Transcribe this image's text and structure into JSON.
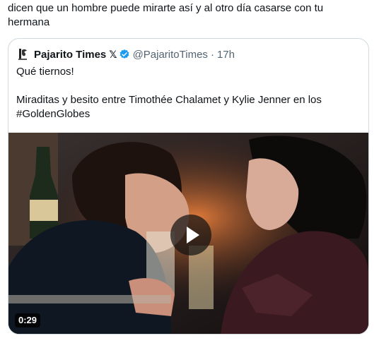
{
  "tweet": {
    "text": "dicen que un hombre puede mirarte así y al otro día casarse con tu hermana"
  },
  "quoted_tweet": {
    "author_name": "Pajarito Times",
    "x_badge": "𝕏",
    "verified_icon": "verified-badge-icon",
    "avatar_icon": "bird-logo-icon",
    "handle": "@PajaritoTimes",
    "separator": "·",
    "time": "17h",
    "line1": "Qué tiernos!",
    "line2": "Miraditas y besito entre Timothée Chalamet y Kylie Jenner en los",
    "line3": "#GoldenGlobes",
    "video": {
      "duration": "0:29",
      "play_icon": "play-icon"
    }
  },
  "colors": {
    "text_primary": "#0f1419",
    "text_secondary": "#536471",
    "verified_blue": "#1d9bf0",
    "card_border": "#cfd9de"
  }
}
